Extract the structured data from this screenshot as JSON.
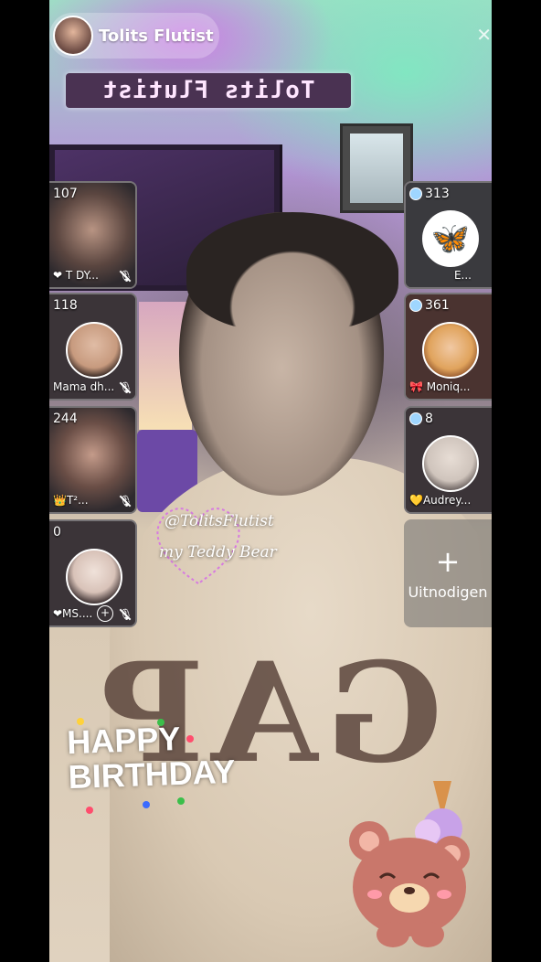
{
  "host": {
    "name": "Tolits Flutist"
  },
  "background_sign": "Tolits Flutist",
  "shirt_text": "GAP",
  "left_guests": [
    {
      "count": "107",
      "label": "❤ T DY...",
      "avatar_color": "#b89483"
    },
    {
      "count": "118",
      "label": "Mama dh...",
      "avatar_color": "#c79a7e"
    },
    {
      "count": "244",
      "label": "👑T²...",
      "avatar_color": "#8c6f63"
    },
    {
      "count": "0",
      "label": "❤MS....",
      "avatar_color": "#d8c2b8"
    }
  ],
  "right_guests": [
    {
      "count": "313",
      "label": "E...",
      "avatar_color": "#1a1a1a"
    },
    {
      "count": "361",
      "label": "🎀 Moniq...",
      "avatar_color": "#e0a35c"
    },
    {
      "count": "8",
      "label": "💛Audrey...",
      "avatar_color": "#cfc4bc"
    }
  ],
  "invite": {
    "label": "Uitnodigen",
    "icon": "plus-icon"
  },
  "mention": "@TolitsFlutist",
  "caption": "my Teddy Bear",
  "birthday": {
    "line1": "HAPPY",
    "line2": "BIRTHDAY"
  },
  "colors": {
    "accent_purple": "#c77dff",
    "tile_bg": "#2e2a2e"
  }
}
